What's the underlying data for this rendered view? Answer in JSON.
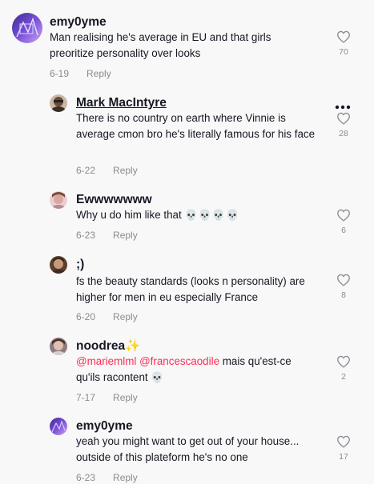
{
  "comments": [
    {
      "username": "emy0yme",
      "text": "Man realising he's average in EU and that girls preoritize personality over looks",
      "date": "6-19",
      "reply": "Reply",
      "likes": "70"
    },
    {
      "username": "Mark MacIntyre",
      "text": "There is no country on earth where Vinnie is average cmon bro he's literally famous for his face",
      "date": "6-22",
      "reply": "Reply",
      "likes": "28"
    },
    {
      "username": "Ewwwwwww",
      "text": "Why u do him like that",
      "emoji": "💀💀💀💀",
      "date": "6-23",
      "reply": "Reply",
      "likes": "6"
    },
    {
      "username": ";)",
      "text": "fs the beauty standards (looks n personality) are higher for men in eu especially France",
      "date": "6-20",
      "reply": "Reply",
      "likes": "8"
    },
    {
      "username": "noodrea",
      "username_emoji": "✨",
      "mention1": "@mariemlml",
      "mention2": "@francescaodile",
      "text_after": "mais qu'est-ce",
      "text_line2": "qu'ils racontent",
      "emoji": "💀",
      "date": "7-17",
      "reply": "Reply",
      "likes": "2"
    },
    {
      "username": "emy0yme",
      "text": "yeah you might want to get out of your house... outside of this plateform he's no one",
      "date": "6-23",
      "reply": "Reply",
      "likes": "17"
    }
  ],
  "colors": {
    "background": "#f8f8f8",
    "text": "#161823",
    "secondary": "#8a8b91",
    "mention": "#fe2c55"
  },
  "icons": {
    "like": "heart-outline-icon",
    "more": "more-horizontal-icon"
  }
}
